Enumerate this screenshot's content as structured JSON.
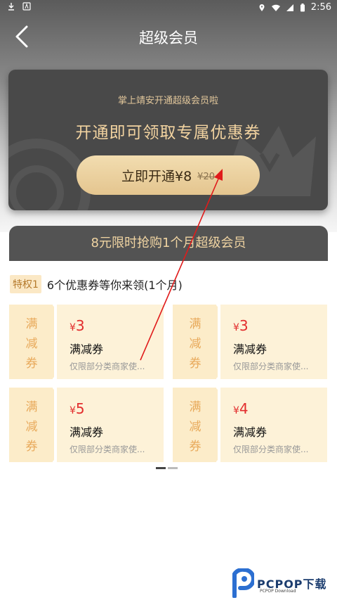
{
  "status_bar": {
    "time": "2:56"
  },
  "nav": {
    "title": "超级会员"
  },
  "vip_card": {
    "subtitle": "掌上靖安开通超级会员啦",
    "headline": "开通即可领取专属优惠券",
    "button_label": "立即开通¥8",
    "original_price": "¥20"
  },
  "flash_banner": {
    "text": "8元限时抢购1个月超级会员"
  },
  "privilege": {
    "tag": "特权1",
    "text": "6个优惠券等你来领(1个月)"
  },
  "coupons": [
    {
      "label": "满减券",
      "currency": "¥",
      "amount": "3",
      "type": "满减券",
      "desc": "仅限部分类商家使..."
    },
    {
      "label": "满减券",
      "currency": "¥",
      "amount": "3",
      "type": "满减券",
      "desc": "仅限部分类商家使..."
    },
    {
      "label": "满减券",
      "currency": "¥",
      "amount": "5",
      "type": "满减券",
      "desc": "仅限部分类商家使..."
    },
    {
      "label": "满减券",
      "currency": "¥",
      "amount": "4",
      "type": "满减券",
      "desc": "仅限部分类商家使..."
    }
  ],
  "watermark": {
    "brand": "PCPOP下载",
    "sub": "PCPOP Download"
  },
  "colors": {
    "accent_gold": "#f2d3a0",
    "price_red": "#e22d2d",
    "annotation_red": "#e01b1b"
  }
}
